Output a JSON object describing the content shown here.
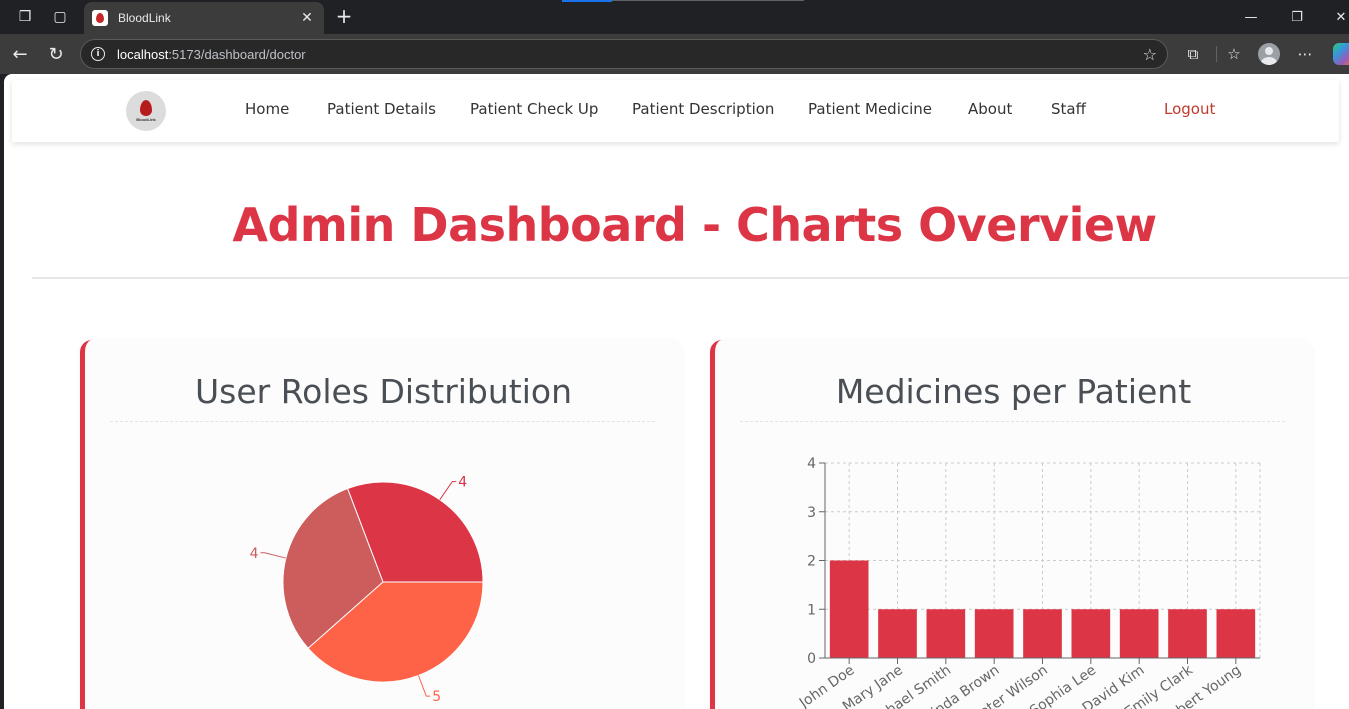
{
  "browser": {
    "tab_title": "BloodLink",
    "url_host": "localhost",
    "url_path": ":5173/dashboard/doctor"
  },
  "navbar": {
    "logo_text": "BloodLink",
    "items": [
      {
        "label": "Home"
      },
      {
        "label": "Patient Details"
      },
      {
        "label": "Patient Check Up"
      },
      {
        "label": "Patient Description"
      },
      {
        "label": "Patient Medicine"
      },
      {
        "label": "About"
      },
      {
        "label": "Staff"
      }
    ],
    "logout_label": "Logout"
  },
  "page": {
    "title": "Admin Dashboard - Charts Overview"
  },
  "colors": {
    "brand_red": "#dc3545",
    "pie_colors": [
      "#dc3545",
      "#cd5c5c",
      "#ff6347"
    ]
  },
  "chart_data": [
    {
      "type": "pie",
      "title": "User Roles Distribution",
      "values": [
        4,
        4,
        5
      ],
      "data_labels": [
        "4",
        "4",
        "5"
      ]
    },
    {
      "type": "bar",
      "title": "Medicines per Patient",
      "categories": [
        "John Doe",
        "Mary Jane",
        "Michael Smith",
        "Linda Brown",
        "Peter Wilson",
        "Sophia Lee",
        "David Kim",
        "Emily Clark",
        "Robert Young"
      ],
      "values": [
        2,
        1,
        1,
        1,
        1,
        1,
        1,
        1,
        1
      ],
      "ylim": [
        0,
        4
      ],
      "yticks": [
        0,
        1,
        2,
        3,
        4
      ],
      "grid": true
    }
  ]
}
